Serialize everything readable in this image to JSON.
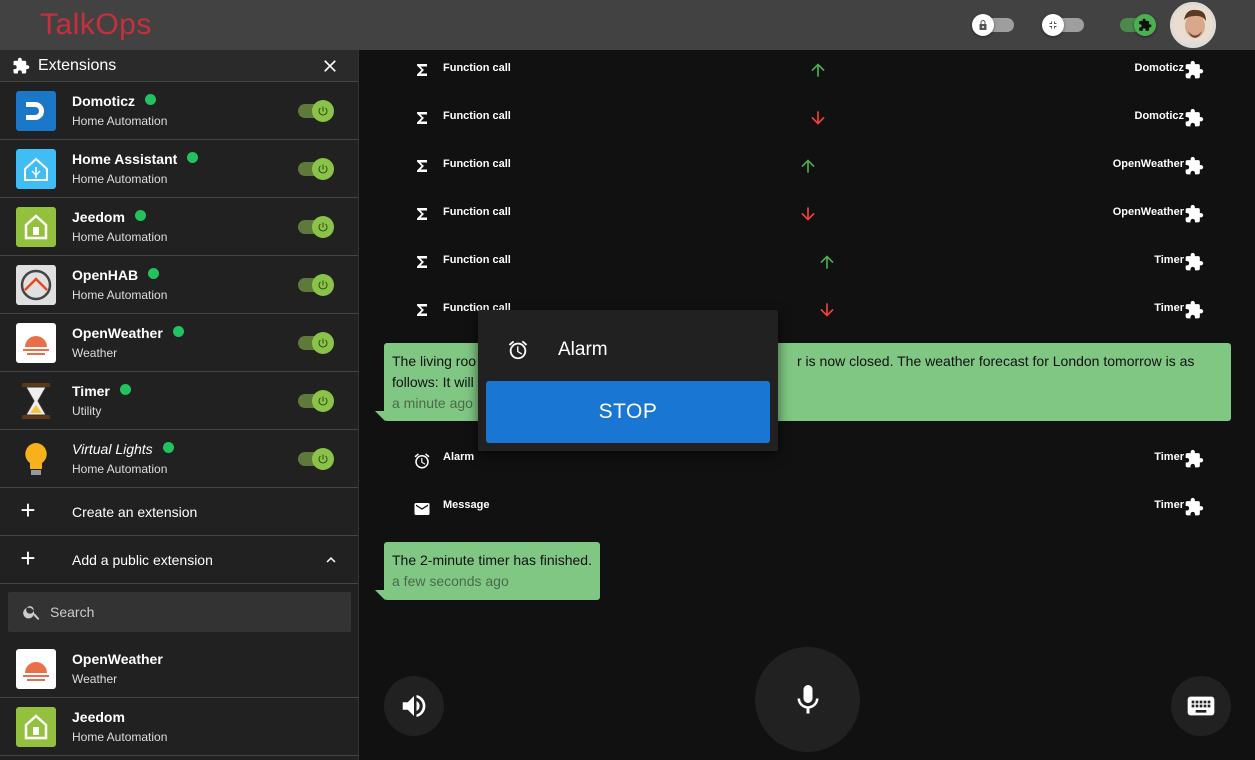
{
  "app": {
    "logo": "TalkOps"
  },
  "topbar": {
    "toggles": [
      "lock-toggle",
      "compact-toggle",
      "extensions-toggle"
    ]
  },
  "sidebar": {
    "title": "Extensions",
    "installed": [
      {
        "name": "Domoticz",
        "category": "Home Automation",
        "icon": "domoticz-icon",
        "color": "#1b78c8"
      },
      {
        "name": "Home Assistant",
        "category": "Home Automation",
        "icon": "home-assistant-icon",
        "color": "#41bdf5"
      },
      {
        "name": "Jeedom",
        "category": "Home Automation",
        "icon": "jeedom-icon",
        "color": "#94c13d"
      },
      {
        "name": "OpenHAB",
        "category": "Home Automation",
        "icon": "openhab-icon",
        "color": "#e0e0e0"
      },
      {
        "name": "OpenWeather",
        "category": "Weather",
        "icon": "openweather-icon",
        "color": "#ffffff"
      },
      {
        "name": "Timer",
        "category": "Utility",
        "icon": "hourglass-icon",
        "color": "#f5c542"
      },
      {
        "name": "Virtual Lights",
        "category": "Home Automation",
        "icon": "lightbulb-icon",
        "color": "#f7b21b"
      }
    ],
    "create_label": "Create an extension",
    "add_public_label": "Add a public extension",
    "search_placeholder": "Search",
    "public": [
      {
        "name": "OpenWeather",
        "category": "Weather"
      },
      {
        "name": "Jeedom",
        "category": "Home Automation"
      }
    ]
  },
  "log": [
    {
      "type": "Function call",
      "direction": "up",
      "source": "Domoticz"
    },
    {
      "type": "Function call",
      "direction": "down",
      "source": "Domoticz"
    },
    {
      "type": "Function call",
      "direction": "up",
      "source": "OpenWeather"
    },
    {
      "type": "Function call",
      "direction": "down",
      "source": "OpenWeather"
    },
    {
      "type": "Function call",
      "direction": "up",
      "source": "Timer"
    },
    {
      "type": "Function call",
      "direction": "down",
      "source": "Timer"
    },
    {
      "type": "Alarm",
      "direction": "",
      "source": "Timer"
    },
    {
      "type": "Message",
      "direction": "",
      "source": "Timer"
    }
  ],
  "messages": [
    {
      "text_left": "The living roo",
      "text_right": "r is now closed. The weather forecast for London tomorrow is as",
      "line2": "follows: It will",
      "time": "a minute ago"
    },
    {
      "text": "The 2-minute timer has finished.",
      "time": "a few seconds ago"
    }
  ],
  "popup": {
    "title": "Alarm",
    "button": "STOP"
  },
  "colors": {
    "up": "#4caf50",
    "down": "#f44336",
    "bubble": "#81c784",
    "stop": "#1976d2"
  }
}
